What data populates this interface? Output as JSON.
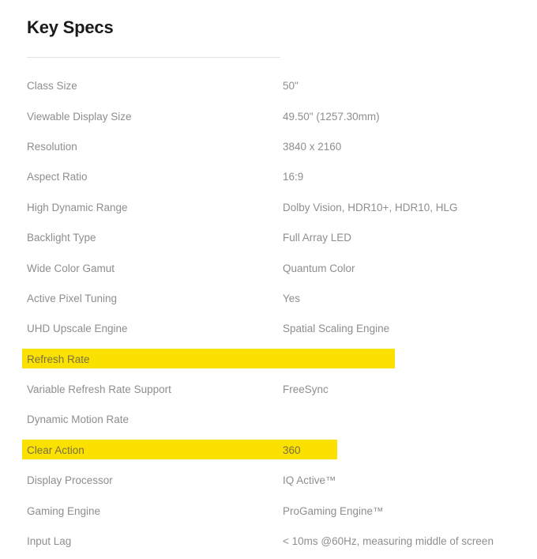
{
  "panel": {
    "title": "Key Specs"
  },
  "specs": {
    "rows": [
      {
        "label": "Class Size",
        "value": "50\"",
        "highlight": "none"
      },
      {
        "label": "Viewable Display Size",
        "value": "49.50\" (1257.30mm)",
        "highlight": "none"
      },
      {
        "label": "Resolution",
        "value": "3840 x 2160",
        "highlight": "none"
      },
      {
        "label": "Aspect Ratio",
        "value": "16:9",
        "highlight": "none"
      },
      {
        "label": "High Dynamic Range",
        "value": "Dolby Vision, HDR10+, HDR10, HLG",
        "highlight": "none"
      },
      {
        "label": "Backlight Type",
        "value": "Full Array LED",
        "highlight": "none"
      },
      {
        "label": "Wide Color Gamut",
        "value": "Quantum Color",
        "highlight": "none"
      },
      {
        "label": "Active Pixel Tuning",
        "value": "Yes",
        "highlight": "none"
      },
      {
        "label": "UHD Upscale Engine",
        "value": "Spatial Scaling Engine",
        "highlight": "none"
      },
      {
        "label": "Refresh Rate",
        "value": "",
        "highlight": "refresh"
      },
      {
        "label": "Variable Refresh Rate Support",
        "value": "FreeSync",
        "highlight": "none"
      },
      {
        "label": "Dynamic Motion Rate",
        "value": "",
        "highlight": "none"
      },
      {
        "label": "Clear Action",
        "value": "360",
        "highlight": "clear"
      },
      {
        "label": "Display Processor",
        "value": "IQ Active™",
        "highlight": "none"
      },
      {
        "label": "Gaming Engine",
        "value": "ProGaming Engine™",
        "highlight": "none"
      },
      {
        "label": "Input Lag",
        "value": "< 10ms @60Hz, measuring middle of screen",
        "highlight": "none"
      }
    ]
  },
  "colors": {
    "highlight_yellow": "#fae100",
    "label_text": "#8e8e8e",
    "title_text": "#1a1a1a",
    "divider": "#e4e4e4",
    "background": "#ffffff"
  }
}
